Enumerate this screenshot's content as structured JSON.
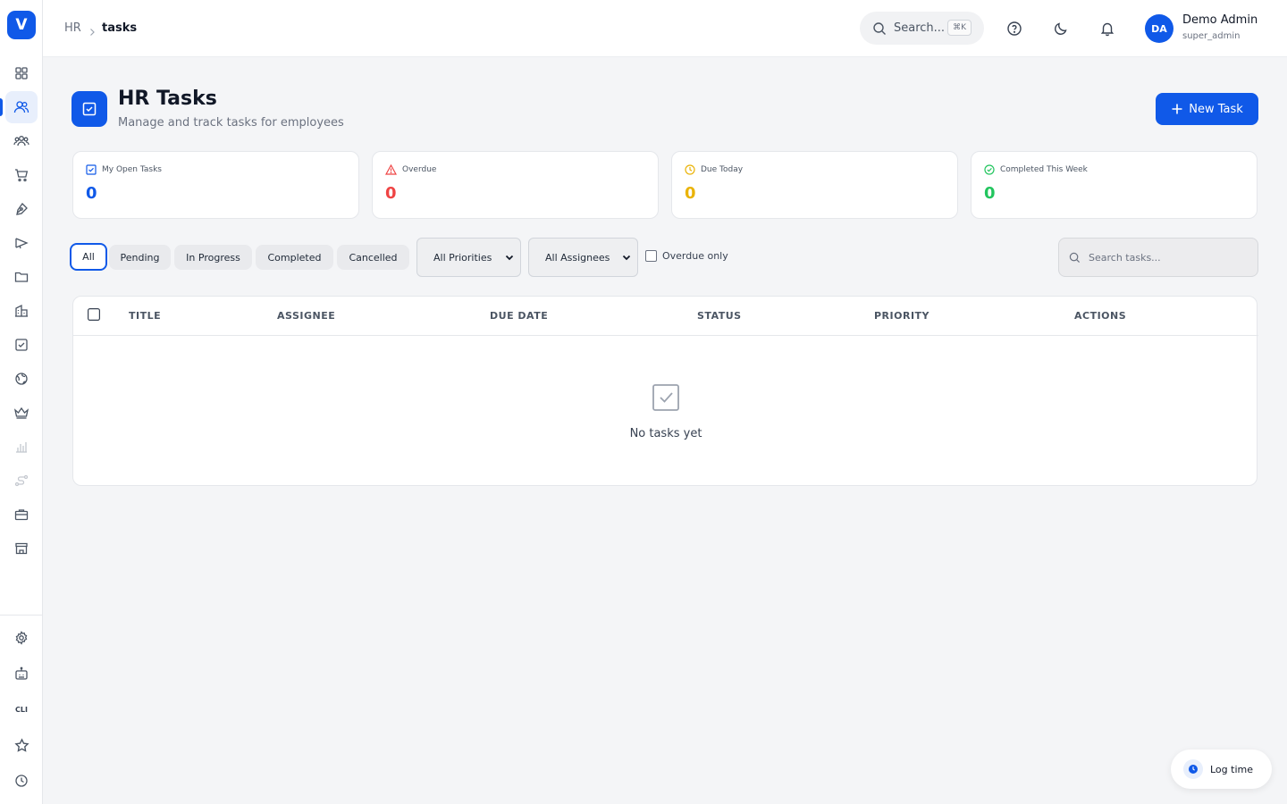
{
  "app": {
    "logo_letter": "V",
    "accent_color": "#1059e8"
  },
  "sidebar": {
    "items": [
      {
        "name": "dashboard",
        "icon": "grid-icon"
      },
      {
        "name": "hr",
        "icon": "users-icon",
        "active": true
      },
      {
        "name": "team",
        "icon": "team-icon"
      },
      {
        "name": "shop",
        "icon": "cart-icon"
      },
      {
        "name": "design",
        "icon": "pen-tool-icon"
      },
      {
        "name": "marketing",
        "icon": "megaphone-icon"
      },
      {
        "name": "files",
        "icon": "folder-icon"
      },
      {
        "name": "company",
        "icon": "building-icon"
      },
      {
        "name": "tasks",
        "icon": "checkbox-icon"
      },
      {
        "name": "web",
        "icon": "globe-icon"
      },
      {
        "name": "premium",
        "icon": "crown-icon"
      },
      {
        "name": "analytics",
        "icon": "bar-chart-icon"
      },
      {
        "name": "routes",
        "icon": "route-icon"
      },
      {
        "name": "jobs",
        "icon": "briefcase-icon"
      },
      {
        "name": "store",
        "icon": "store-icon"
      }
    ],
    "bottom_items": [
      {
        "name": "settings",
        "icon": "gear-icon"
      },
      {
        "name": "bot",
        "icon": "bot-icon"
      },
      {
        "name": "cli",
        "label": "CLI"
      },
      {
        "name": "favorites",
        "icon": "star-icon"
      },
      {
        "name": "history",
        "icon": "clock-icon"
      }
    ]
  },
  "header": {
    "breadcrumb_root": "HR",
    "breadcrumb_separator": "›",
    "breadcrumb_current": "tasks",
    "search_placeholder": "Search...",
    "search_shortcut": "⌘K",
    "user": {
      "initials": "DA",
      "name": "Demo Admin",
      "role": "super_admin"
    }
  },
  "page": {
    "title": "HR Tasks",
    "subtitle": "Manage and track tasks for employees",
    "new_task_label": "New Task"
  },
  "stats": [
    {
      "label": "My Open Tasks",
      "value": "0",
      "color": "#1059e8",
      "icon": "checkbox-icon"
    },
    {
      "label": "Overdue",
      "value": "0",
      "color": "#ef4444",
      "icon": "alert-triangle-icon"
    },
    {
      "label": "Due Today",
      "value": "0",
      "color": "#eab308",
      "icon": "clock-icon"
    },
    {
      "label": "Completed This Week",
      "value": "0",
      "color": "#22c55e",
      "icon": "check-circle-icon"
    }
  ],
  "filters": {
    "status_tabs": [
      "All",
      "Pending",
      "In Progress",
      "Completed",
      "Cancelled"
    ],
    "active_tab": "All",
    "priority_select": "All Priorities",
    "assignee_select": "All Assignees",
    "overdue_only_label": "Overdue only",
    "overdue_only_checked": false,
    "search_placeholder": "Search tasks..."
  },
  "table": {
    "columns": [
      "TITLE",
      "ASSIGNEE",
      "DUE DATE",
      "STATUS",
      "PRIORITY",
      "ACTIONS"
    ],
    "rows": [],
    "empty_text": "No tasks yet"
  },
  "log_time": {
    "label": "Log time"
  }
}
